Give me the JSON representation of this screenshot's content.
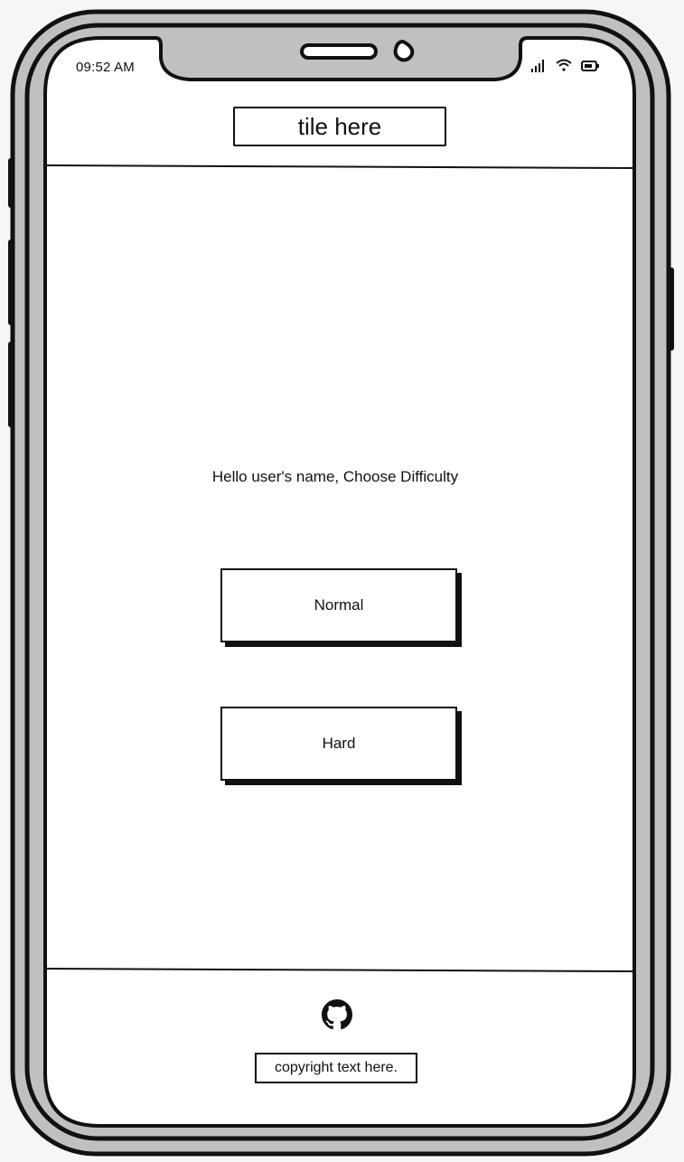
{
  "status_bar": {
    "time": "09:52 AM",
    "icons": [
      "signal-icon",
      "wifi-icon",
      "battery-icon"
    ]
  },
  "header": {
    "title": "tile here"
  },
  "main": {
    "greeting": "Hello user's name, Choose Difficulty",
    "buttons": [
      {
        "label": "Normal"
      },
      {
        "label": "Hard"
      }
    ]
  },
  "footer": {
    "icon": "github-icon",
    "copyright": "copyright text here."
  },
  "colors": {
    "frame": "#c0c0c0",
    "stroke": "#111111",
    "screen": "#ffffff"
  }
}
